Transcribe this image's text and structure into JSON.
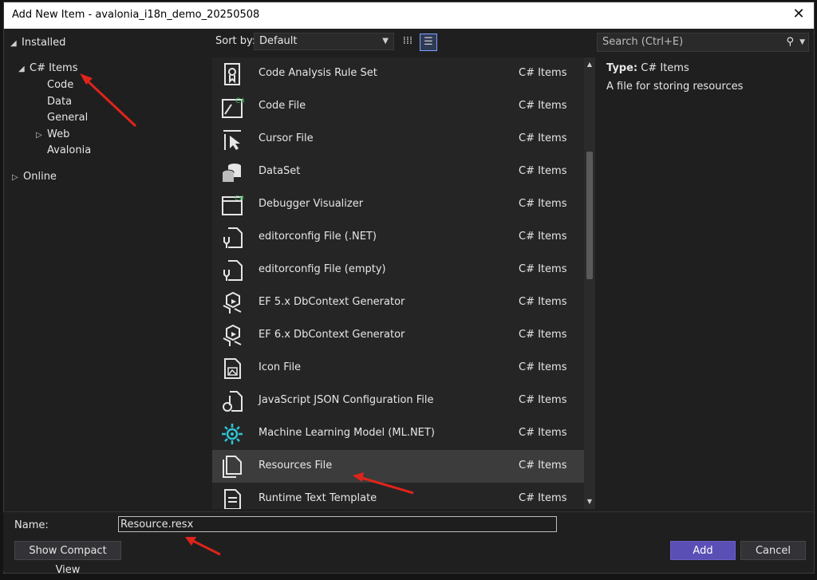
{
  "window": {
    "title": "Add New Item - avalonia_i18n_demo_20250508"
  },
  "tree": {
    "installed": "Installed",
    "csharp_items": "C# Items",
    "code": "Code",
    "data": "Data",
    "general": "General",
    "web": "Web",
    "avalonia": "Avalonia",
    "online": "Online"
  },
  "toolbar": {
    "sort_label": "Sort by:",
    "sort_value": "Default"
  },
  "search": {
    "placeholder": "Search (Ctrl+E)"
  },
  "items": [
    {
      "name": "Code Analysis Rule Set",
      "category": "C# Items",
      "icon": "rule-set-icon"
    },
    {
      "name": "Code File",
      "category": "C# Items",
      "icon": "code-file-icon"
    },
    {
      "name": "Cursor File",
      "category": "C# Items",
      "icon": "cursor-icon"
    },
    {
      "name": "DataSet",
      "category": "C# Items",
      "icon": "dataset-icon"
    },
    {
      "name": "Debugger Visualizer",
      "category": "C# Items",
      "icon": "window-icon"
    },
    {
      "name": "editorconfig File (.NET)",
      "category": "C# Items",
      "icon": "config-file-icon"
    },
    {
      "name": "editorconfig File (empty)",
      "category": "C# Items",
      "icon": "config-file-icon"
    },
    {
      "name": "EF 5.x DbContext Generator",
      "category": "C# Items",
      "icon": "generator-icon"
    },
    {
      "name": "EF 6.x DbContext Generator",
      "category": "C# Items",
      "icon": "generator-icon"
    },
    {
      "name": "Icon File",
      "category": "C# Items",
      "icon": "icon-file-icon"
    },
    {
      "name": "JavaScript JSON Configuration File",
      "category": "C# Items",
      "icon": "json-file-icon"
    },
    {
      "name": "Machine Learning Model (ML.NET)",
      "category": "C# Items",
      "icon": "ml-model-icon"
    },
    {
      "name": "Resources File",
      "category": "C# Items",
      "icon": "resources-file-icon"
    },
    {
      "name": "Runtime Text Template",
      "category": "C# Items",
      "icon": "text-template-icon"
    }
  ],
  "details": {
    "type_label": "Type:",
    "type_value": "C# Items",
    "description": "A file for storing resources"
  },
  "bottom": {
    "name_label": "Name:",
    "name_value": "Resource.resx",
    "compact_view": "Show Compact View",
    "add": "Add",
    "cancel": "Cancel"
  },
  "colors": {
    "accent": "#5a4fb5",
    "annotation": "#e0241b",
    "ml_icon": "#2ec5d3"
  }
}
